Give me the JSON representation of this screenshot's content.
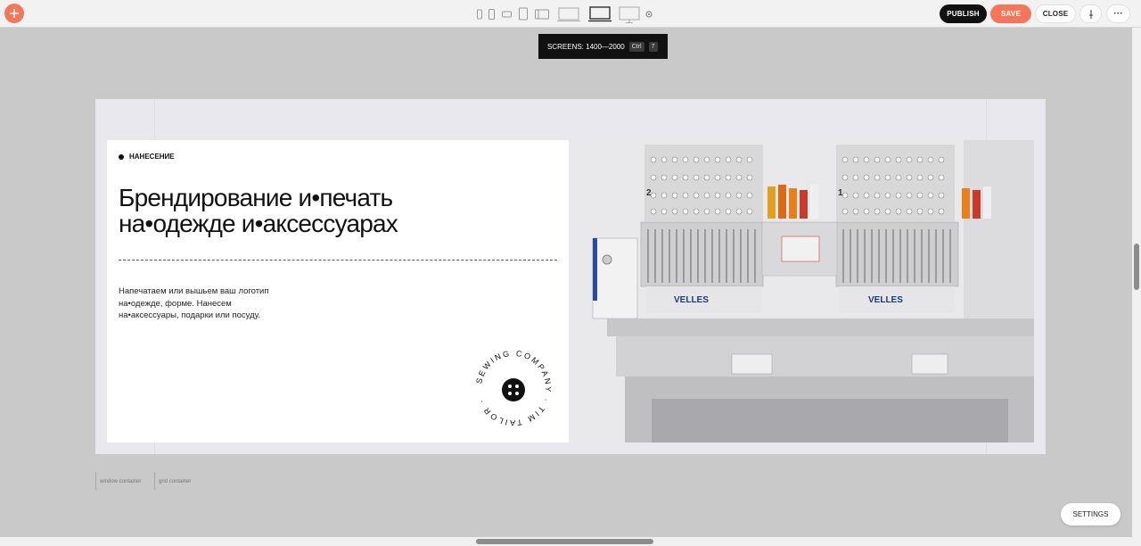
{
  "toolbar": {
    "publish_label": "PUBLISH",
    "save_label": "SAVE",
    "close_label": "CLOSE",
    "pin_label": "'",
    "more_label": "···",
    "accent_color": "#f4775c",
    "devices": [
      "phone-portrait-small-icon",
      "phone-portrait-icon",
      "phone-landscape-icon",
      "tablet-portrait-icon",
      "tablet-landscape-icon",
      "laptop-small-icon",
      "laptop-icon",
      "desktop-icon",
      "gear-icon"
    ],
    "selected_device": "laptop-icon"
  },
  "tooltip": {
    "text": "SCREENS: 1400—2000",
    "key1": "Ctrl",
    "key2": "7"
  },
  "block": {
    "tag": "НАНЕСЕНИЕ",
    "headline_line1": "Брендирование и•печать",
    "headline_line2": "на•одежде и•аксессуарах",
    "body_line1": "Напечатаем или вышьем ваш логотип",
    "body_line2": "на•одежде, форме. Нанесем",
    "body_line3": "на•аксессуары, подарки или посуду.",
    "badge_text": "SEWING COMPANY · TIM TAILOR ·",
    "photo_machine_brand": "VELLES",
    "photo_head_numbers": [
      "2",
      "1"
    ]
  },
  "guides": {
    "window_label": "window container",
    "grid_label": "grid container"
  },
  "settings_label": "SETTINGS"
}
